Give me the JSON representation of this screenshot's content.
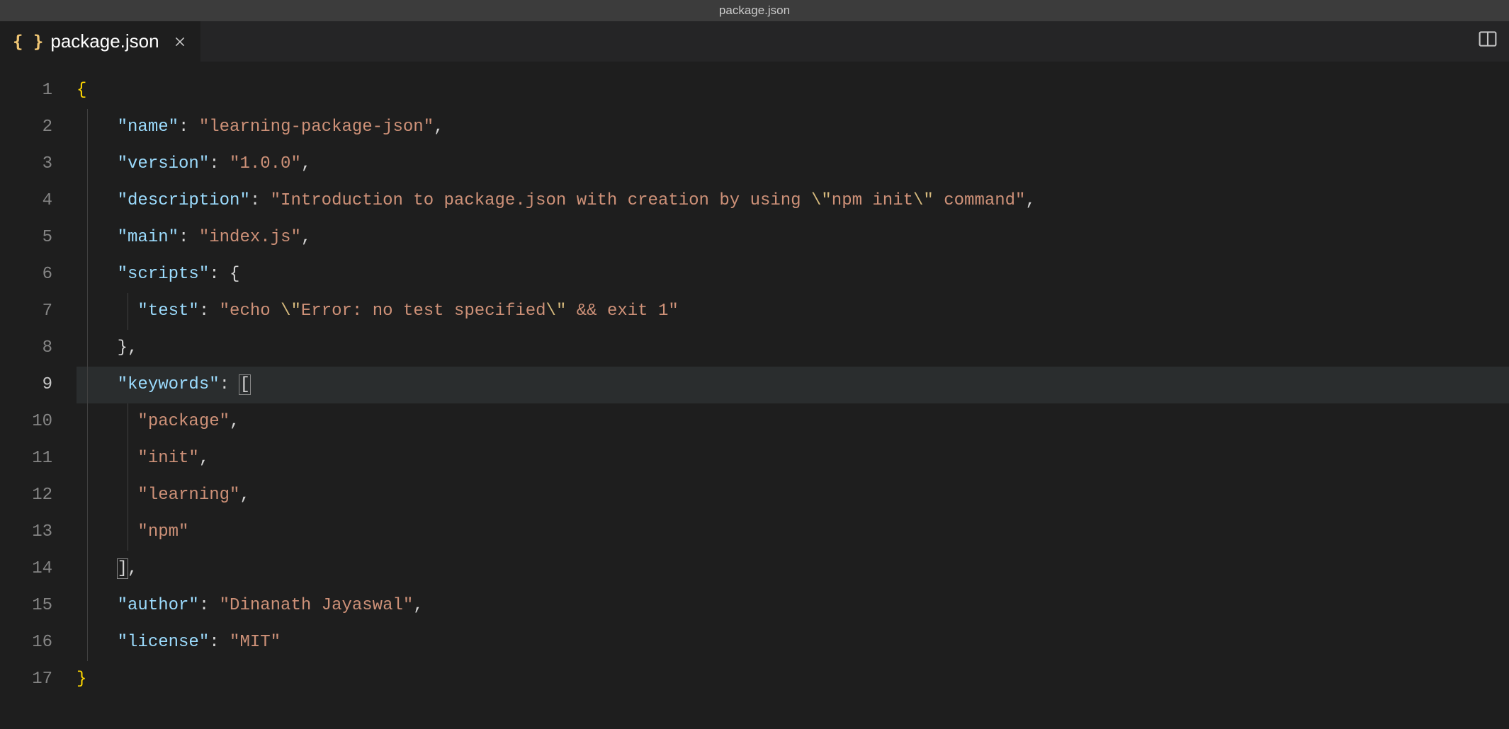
{
  "titleBar": {
    "title": "package.json"
  },
  "tab": {
    "icon": "{ }",
    "filename": "package.json"
  },
  "lineCount": 17,
  "activeLine": 9,
  "code": {
    "l1": "{",
    "l2": {
      "key": "\"name\"",
      "value": "\"learning-package-json\""
    },
    "l3": {
      "key": "\"version\"",
      "value": "\"1.0.0\""
    },
    "l4": {
      "key": "\"description\"",
      "value_pre": "\"Introduction to package.json with creation by using ",
      "esc1": "\\\"",
      "mid": "npm init",
      "esc2": "\\\"",
      "value_post": " command\""
    },
    "l5": {
      "key": "\"main\"",
      "value": "\"index.js\""
    },
    "l6": {
      "key": "\"scripts\"",
      "brace": "{"
    },
    "l7": {
      "key": "\"test\"",
      "value_pre": "\"echo ",
      "esc1": "\\\"",
      "mid": "Error: no test specified",
      "esc2": "\\\"",
      "value_post": " && exit 1\""
    },
    "l8": {
      "brace": "}",
      "comma": ","
    },
    "l9": {
      "key": "\"keywords\"",
      "bracket": "["
    },
    "l10": {
      "value": "\"package\""
    },
    "l11": {
      "value": "\"init\""
    },
    "l12": {
      "value": "\"learning\""
    },
    "l13": {
      "value": "\"npm\""
    },
    "l14": {
      "bracket": "]",
      "comma": ","
    },
    "l15": {
      "key": "\"author\"",
      "value": "\"Dinanath Jayaswal\""
    },
    "l16": {
      "key": "\"license\"",
      "value": "\"MIT\""
    },
    "l17": "}"
  },
  "gutter": {
    "n1": "1",
    "n2": "2",
    "n3": "3",
    "n4": "4",
    "n5": "5",
    "n6": "6",
    "n7": "7",
    "n8": "8",
    "n9": "9",
    "n10": "10",
    "n11": "11",
    "n12": "12",
    "n13": "13",
    "n14": "14",
    "n15": "15",
    "n16": "16",
    "n17": "17"
  }
}
